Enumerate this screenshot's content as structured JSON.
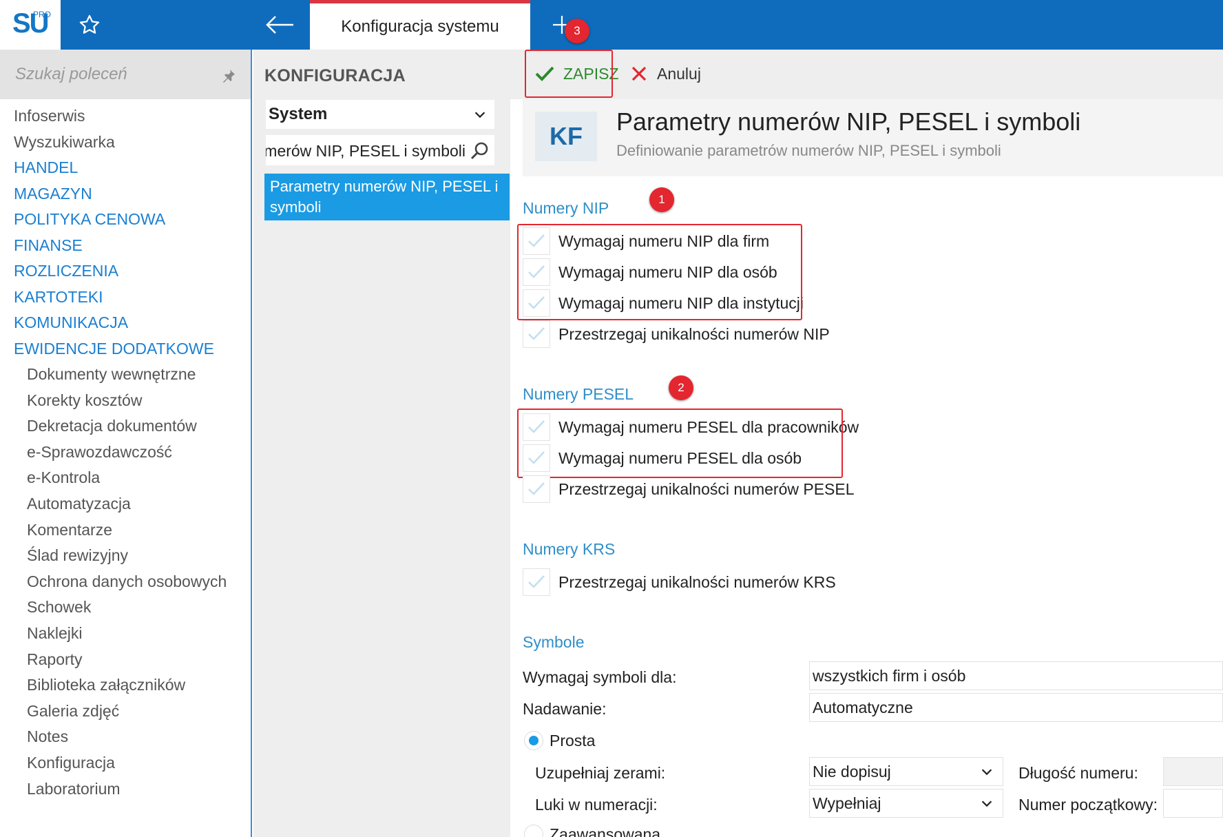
{
  "app": {
    "logo_text": "SU",
    "logo_sup": "PRO",
    "active_tab": "Konfiguracja systemu"
  },
  "sidebar": {
    "search_placeholder": "Szukaj poleceń",
    "items": [
      {
        "label": "Infoserwis",
        "type": "link"
      },
      {
        "label": "Wyszukiwarka",
        "type": "link"
      },
      {
        "label": "HANDEL",
        "type": "module"
      },
      {
        "label": "MAGAZYN",
        "type": "module"
      },
      {
        "label": "POLITYKA CENOWA",
        "type": "module"
      },
      {
        "label": "FINANSE",
        "type": "module"
      },
      {
        "label": "ROZLICZENIA",
        "type": "module"
      },
      {
        "label": "KARTOTEKI",
        "type": "module"
      },
      {
        "label": "KOMUNIKACJA",
        "type": "module"
      },
      {
        "label": "EWIDENCJE DODATKOWE",
        "type": "module"
      }
    ],
    "subitems": [
      "Dokumenty wewnętrzne",
      "Korekty kosztów",
      "Dekretacja dokumentów",
      "e-Sprawozdawczość",
      "e-Kontrola",
      "Automatyzacja",
      "Komentarze",
      "Ślad rewizyjny",
      "Ochrona danych osobowych",
      "Schowek",
      "Naklejki",
      "Raporty",
      "Biblioteka załączników",
      "Galeria zdjęć",
      "Notes",
      "Konfiguracja",
      "Laboratorium"
    ]
  },
  "middle": {
    "title": "KONFIGURACJA",
    "select_value": "System",
    "filter_value": "merów NIP, PESEL i symboli",
    "result_item": "Parametry numerów NIP, PESEL i symboli"
  },
  "toolbar": {
    "save_label": "ZAPISZ",
    "cancel_label": "Anuluj"
  },
  "form": {
    "icon_text": "KF",
    "title": "Parametry numerów NIP, PESEL i symboli",
    "subtitle": "Definiowanie parametrów numerów NIP, PESEL i symboli",
    "nip": {
      "title": "Numery NIP",
      "options": [
        "Wymagaj numeru NIP dla firm",
        "Wymagaj numeru NIP dla osób",
        "Wymagaj numeru NIP dla instytucji",
        "Przestrzegaj unikalności numerów NIP"
      ]
    },
    "pesel": {
      "title": "Numery PESEL",
      "options": [
        "Wymagaj numeru PESEL dla pracowników",
        "Wymagaj numeru PESEL dla osób",
        "Przestrzegaj unikalności numerów PESEL"
      ]
    },
    "krs": {
      "title": "Numery KRS",
      "options": [
        "Przestrzegaj unikalności numerów KRS"
      ]
    },
    "symbole": {
      "title": "Symbole",
      "require_label": "Wymagaj symboli dla:",
      "require_value": "wszystkich firm i osób",
      "assign_label": "Nadawanie:",
      "assign_value": "Automatyczne",
      "radio_simple": "Prosta",
      "zeros_label": "Uzupełniaj zerami:",
      "zeros_value": "Nie dopisuj",
      "gaps_label": "Luki w numeracji:",
      "gaps_value": "Wypełniaj",
      "length_label": "Długość numeru:",
      "start_label": "Numer początkowy:",
      "radio_advanced": "Zaawansowana"
    }
  },
  "badges": {
    "one": "1",
    "two": "2",
    "three": "3"
  },
  "colors": {
    "topbar": "#0f6cbd",
    "accent": "#1a9be4",
    "section": "#2f8fc8",
    "highlight": "#e3262f",
    "save": "#2d8a2d"
  },
  "icons": [
    "star-icon",
    "back-arrow-icon",
    "plus-icon",
    "pin-icon",
    "chevron-down-icon",
    "search-icon",
    "checkmark-icon",
    "x-icon"
  ]
}
